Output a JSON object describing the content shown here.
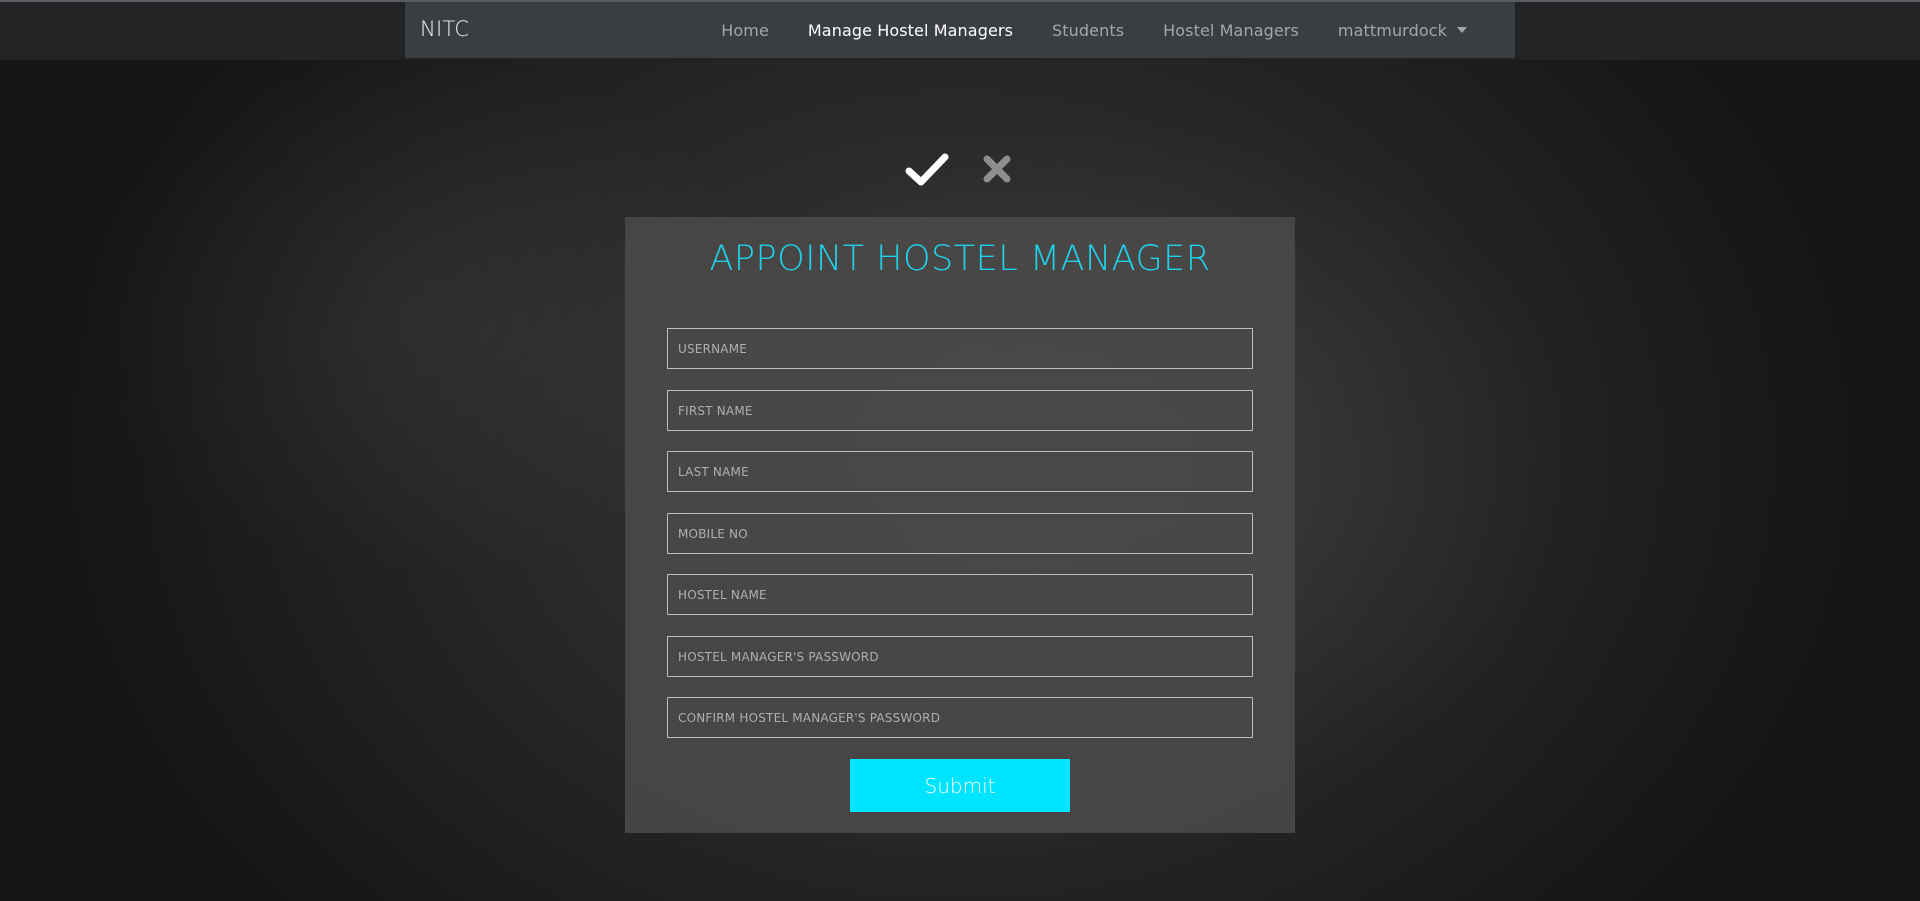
{
  "navbar": {
    "brand": "NITC",
    "links": [
      {
        "label": "Home",
        "active": false
      },
      {
        "label": "Manage Hostel Managers",
        "active": true
      },
      {
        "label": "Students",
        "active": false
      },
      {
        "label": "Hostel Managers",
        "active": false
      }
    ],
    "user_menu": {
      "label": "mattmurdock",
      "icon": "caret-down-icon"
    }
  },
  "icons": {
    "confirm": "check-icon",
    "cancel": "close-icon"
  },
  "form": {
    "title": "APPOINT HOSTEL MANAGER",
    "fields": {
      "username": {
        "placeholder": "USERNAME",
        "value": ""
      },
      "first_name": {
        "placeholder": "FIRST NAME",
        "value": ""
      },
      "last_name": {
        "placeholder": "LAST NAME",
        "value": ""
      },
      "mobile_no": {
        "placeholder": "MOBILE NO",
        "value": ""
      },
      "hostel_name": {
        "placeholder": "HOSTEL NAME",
        "value": ""
      },
      "password": {
        "placeholder": "HOSTEL MANAGER'S PASSWORD",
        "value": ""
      },
      "confirm_password": {
        "placeholder": "CONFIRM HOSTEL MANAGER'S PASSWORD",
        "value": ""
      }
    },
    "submit_label": "Submit"
  },
  "colors": {
    "accent": "#1ed2ee",
    "button": "#00e5ff",
    "navbar": "#3a3e43",
    "card": "#4a4947"
  }
}
